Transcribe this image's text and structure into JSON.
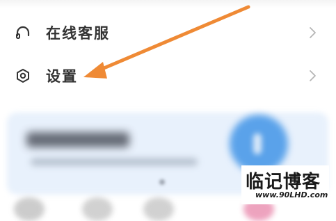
{
  "menu": {
    "items": [
      {
        "label": "在线客服",
        "icon": "headset-icon"
      },
      {
        "label": "设置",
        "icon": "settings-gear-icon"
      }
    ]
  },
  "colors": {
    "arrow": "#ef8a35",
    "label_text": "#333333",
    "card_background": "#e8f1fc",
    "card_accent": "#5aa2ea",
    "chevron": "#b5b5b5"
  },
  "watermark": {
    "title": "临记博客",
    "url": "www.90LHD.com"
  }
}
